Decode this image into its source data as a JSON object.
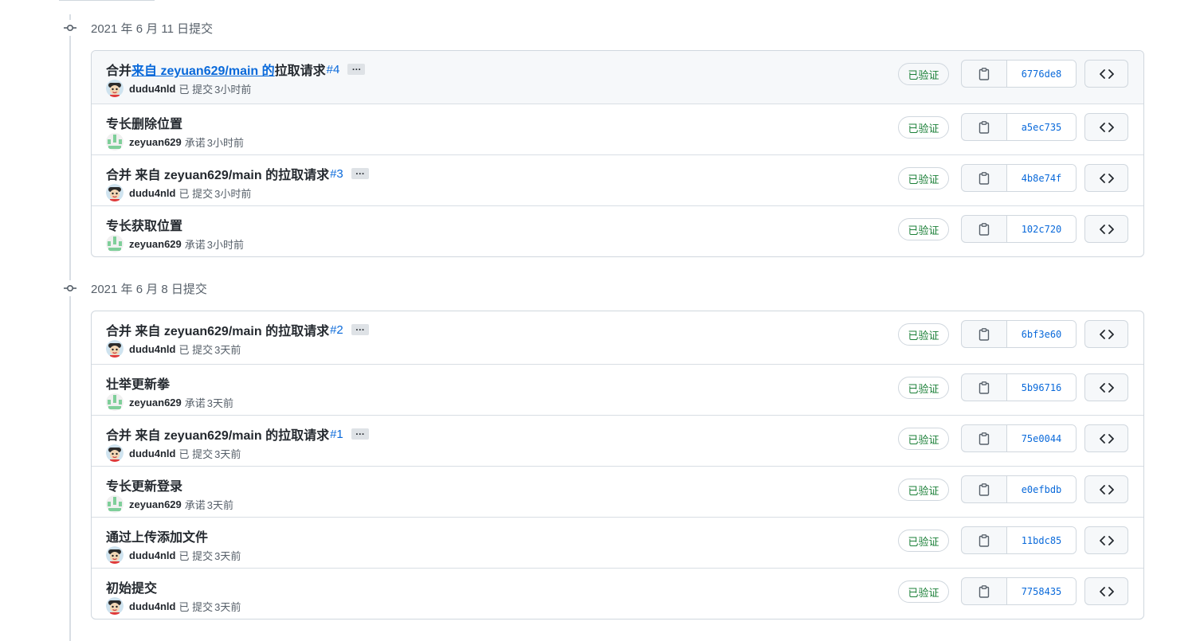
{
  "colors": {
    "link": "#0969da",
    "verified": "#1a7f37",
    "border": "#d0d7de",
    "muted": "#57606a"
  },
  "groups": [
    {
      "title": "2021 年 6 月 11 日提交",
      "commits": [
        {
          "title_pre": "合并 ",
          "title_link": "来自 zeyuan629/main 的",
          "title_post": "拉取请求",
          "pr": "#4",
          "ellipsis": "…",
          "author": "dudu4nld",
          "verb": "已 提交",
          "time": "3小时前",
          "avatar": "cartoon-avatar-icon",
          "verified": "已验证",
          "sha": "6776de8",
          "highlight": true
        },
        {
          "title_pre": "专长删除位置",
          "title_link": "",
          "title_post": "",
          "pr": "",
          "ellipsis": "",
          "author": "zeyuan629",
          "verb": "承诺",
          "time": "3小时前",
          "avatar": "identicon-avatar-icon",
          "verified": "已验证",
          "sha": "a5ec735",
          "highlight": false
        },
        {
          "title_pre": "合并 来自 zeyuan629/main 的拉取请求",
          "title_link": "",
          "title_post": "",
          "pr": "#3",
          "ellipsis": "…",
          "author": "dudu4nld",
          "verb": "已 提交",
          "time": "3小时前",
          "avatar": "cartoon-avatar-icon",
          "verified": "已验证",
          "sha": "4b8e74f",
          "highlight": false
        },
        {
          "title_pre": "专长获取位置",
          "title_link": "",
          "title_post": "",
          "pr": "",
          "ellipsis": "",
          "author": "zeyuan629",
          "verb": "承诺",
          "time": "3小时前",
          "avatar": "identicon-avatar-icon",
          "verified": "已验证",
          "sha": "102c720",
          "highlight": false
        }
      ]
    },
    {
      "title": "2021 年 6 月 8 日提交",
      "commits": [
        {
          "title_pre": "合并 来自 zeyuan629/main 的拉取请求",
          "title_link": "",
          "title_post": "",
          "pr": "#2",
          "ellipsis": "…",
          "author": "dudu4nld",
          "verb": "已 提交",
          "time": "3天前",
          "avatar": "cartoon-avatar-icon",
          "verified": "已验证",
          "sha": "6bf3e60",
          "highlight": false
        },
        {
          "title_pre": "壮举更新拳",
          "title_link": "",
          "title_post": "",
          "pr": "",
          "ellipsis": "",
          "author": "zeyuan629",
          "verb": "承诺",
          "time": "3天前",
          "avatar": "identicon-avatar-icon",
          "verified": "已验证",
          "sha": "5b96716",
          "highlight": false
        },
        {
          "title_pre": "合并 来自 zeyuan629/main 的拉取请求",
          "title_link": "",
          "title_post": "",
          "pr": "#1",
          "ellipsis": "…",
          "author": "dudu4nld",
          "verb": "已 提交",
          "time": "3天前",
          "avatar": "cartoon-avatar-icon",
          "verified": "已验证",
          "sha": "75e0044",
          "highlight": false
        },
        {
          "title_pre": "专长更新登录",
          "title_link": "",
          "title_post": "",
          "pr": "",
          "ellipsis": "",
          "author": "zeyuan629",
          "verb": "承诺",
          "time": "3天前",
          "avatar": "identicon-avatar-icon",
          "verified": "已验证",
          "sha": "e0efbdb",
          "highlight": false
        },
        {
          "title_pre": "通过上传添加文件",
          "title_link": "",
          "title_post": "",
          "pr": "",
          "ellipsis": "",
          "author": "dudu4nld",
          "verb": "已 提交",
          "time": "3天前",
          "avatar": "cartoon-avatar-icon",
          "verified": "已验证",
          "sha": "11bdc85",
          "highlight": false
        },
        {
          "title_pre": "初始提交",
          "title_link": "",
          "title_post": "",
          "pr": "",
          "ellipsis": "",
          "author": "dudu4nld",
          "verb": "已 提交",
          "time": "3天前",
          "avatar": "cartoon-avatar-icon",
          "verified": "已验证",
          "sha": "7758435",
          "highlight": false
        }
      ]
    }
  ]
}
